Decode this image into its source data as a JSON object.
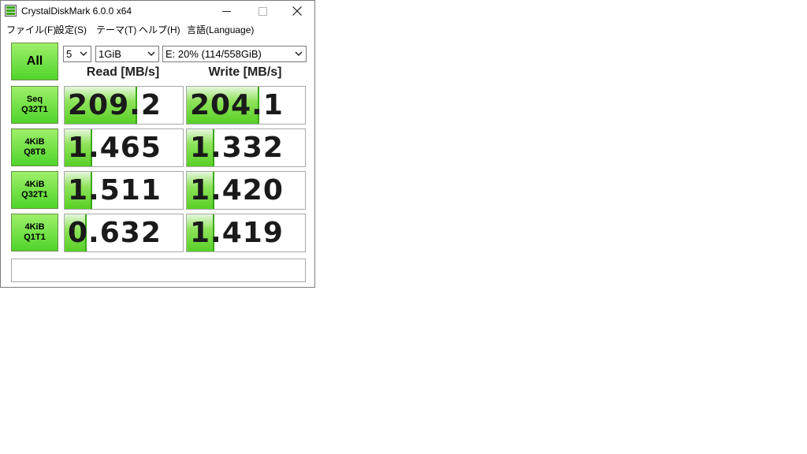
{
  "window": {
    "title": "CrystalDiskMark 6.0.0 x64",
    "minimize_icon": "minimize-icon",
    "maximize_icon": "maximize-icon",
    "close_icon": "close-icon"
  },
  "menu": [
    "ファイル(F)",
    "設定(S)",
    "テーマ(T)",
    "ヘルプ(H)",
    "言語(Language)"
  ],
  "controls": {
    "all_label": "All",
    "count": "5",
    "size": "1GiB",
    "drive": "E: 20% (114/558GiB)"
  },
  "headers": {
    "read": "Read [MB/s]",
    "write": "Write [MB/s]"
  },
  "tests": [
    {
      "line1": "Seq",
      "line2": "Q32T1",
      "read": "209.2",
      "write": "204.1",
      "read_level": 0.6,
      "write_level": 0.6
    },
    {
      "line1": "4KiB",
      "line2": "Q8T8",
      "read": "1.465",
      "write": "1.332",
      "read_level": 0.22,
      "write_level": 0.22
    },
    {
      "line1": "4KiB",
      "line2": "Q32T1",
      "read": "1.511",
      "write": "1.420",
      "read_level": 0.22,
      "write_level": 0.22
    },
    {
      "line1": "4KiB",
      "line2": "Q1T1",
      "read": "0.632",
      "write": "1.419",
      "read_level": 0.17,
      "write_level": 0.22
    }
  ],
  "status": "",
  "colors": {
    "accent_green": "#57cf25",
    "button_green": "#4fd42a"
  }
}
